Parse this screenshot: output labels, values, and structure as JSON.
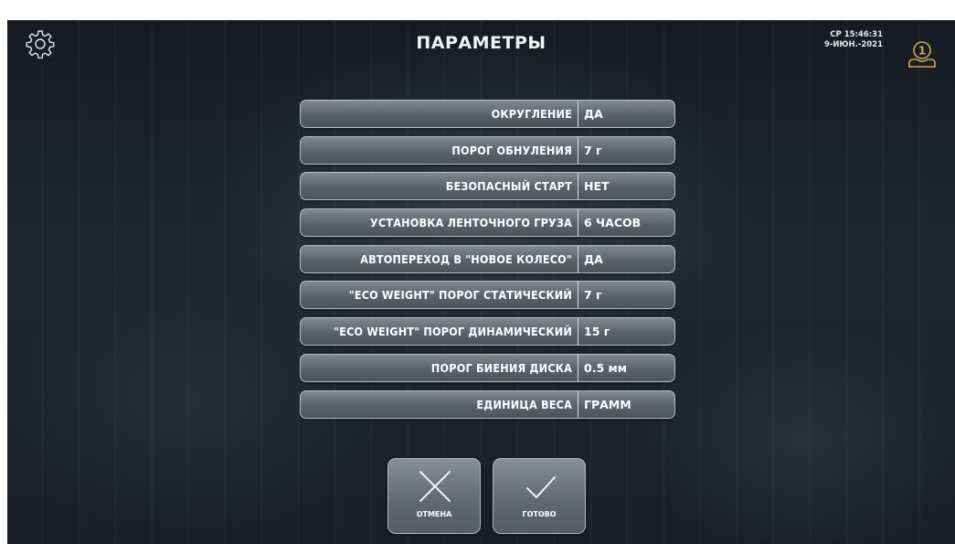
{
  "header": {
    "title": "ПАРАМЕТРЫ",
    "time": "СР 15:46:31",
    "date": "9-ИЮН.-2021",
    "user_number": "1"
  },
  "icons": {
    "settings": "gear-icon",
    "user": "user-profile-icon",
    "cancel": "x-cross-icon",
    "done": "checkmark-icon"
  },
  "params": [
    {
      "label": "ОКРУГЛЕНИЕ",
      "value": "ДА"
    },
    {
      "label": "ПОРОГ ОБНУЛЕНИЯ",
      "value": "7 г"
    },
    {
      "label": "БЕЗОПАСНЫЙ СТАРТ",
      "value": "НЕТ"
    },
    {
      "label": "УСТАНОВКА ЛЕНТОЧНОГО ГРУЗА",
      "value": "6 ЧАСОВ"
    },
    {
      "label": "АВТОПЕРЕХОД В \"НОВОЕ КОЛЕСО\"",
      "value": "ДА"
    },
    {
      "label": "\"ECO WEIGHT\" ПОРОГ СТАТИЧЕСКИЙ",
      "value": "7 г"
    },
    {
      "label": "\"ECO WEIGHT\" ПОРОГ ДИНАМИЧЕСКИЙ",
      "value": "15 г"
    },
    {
      "label": "ПОРОГ БИЕНИЯ ДИСКА",
      "value": "0.5 мм"
    },
    {
      "label": "ЕДИНИЦА ВЕСА",
      "value": "ГРАММ"
    }
  ],
  "actions": {
    "cancel_label": "ОТМЕНА",
    "done_label": "ГОТОВО"
  },
  "colors": {
    "accent_icon": "#c9a65a",
    "text": "#ffffff",
    "button": "#6a6f76"
  }
}
